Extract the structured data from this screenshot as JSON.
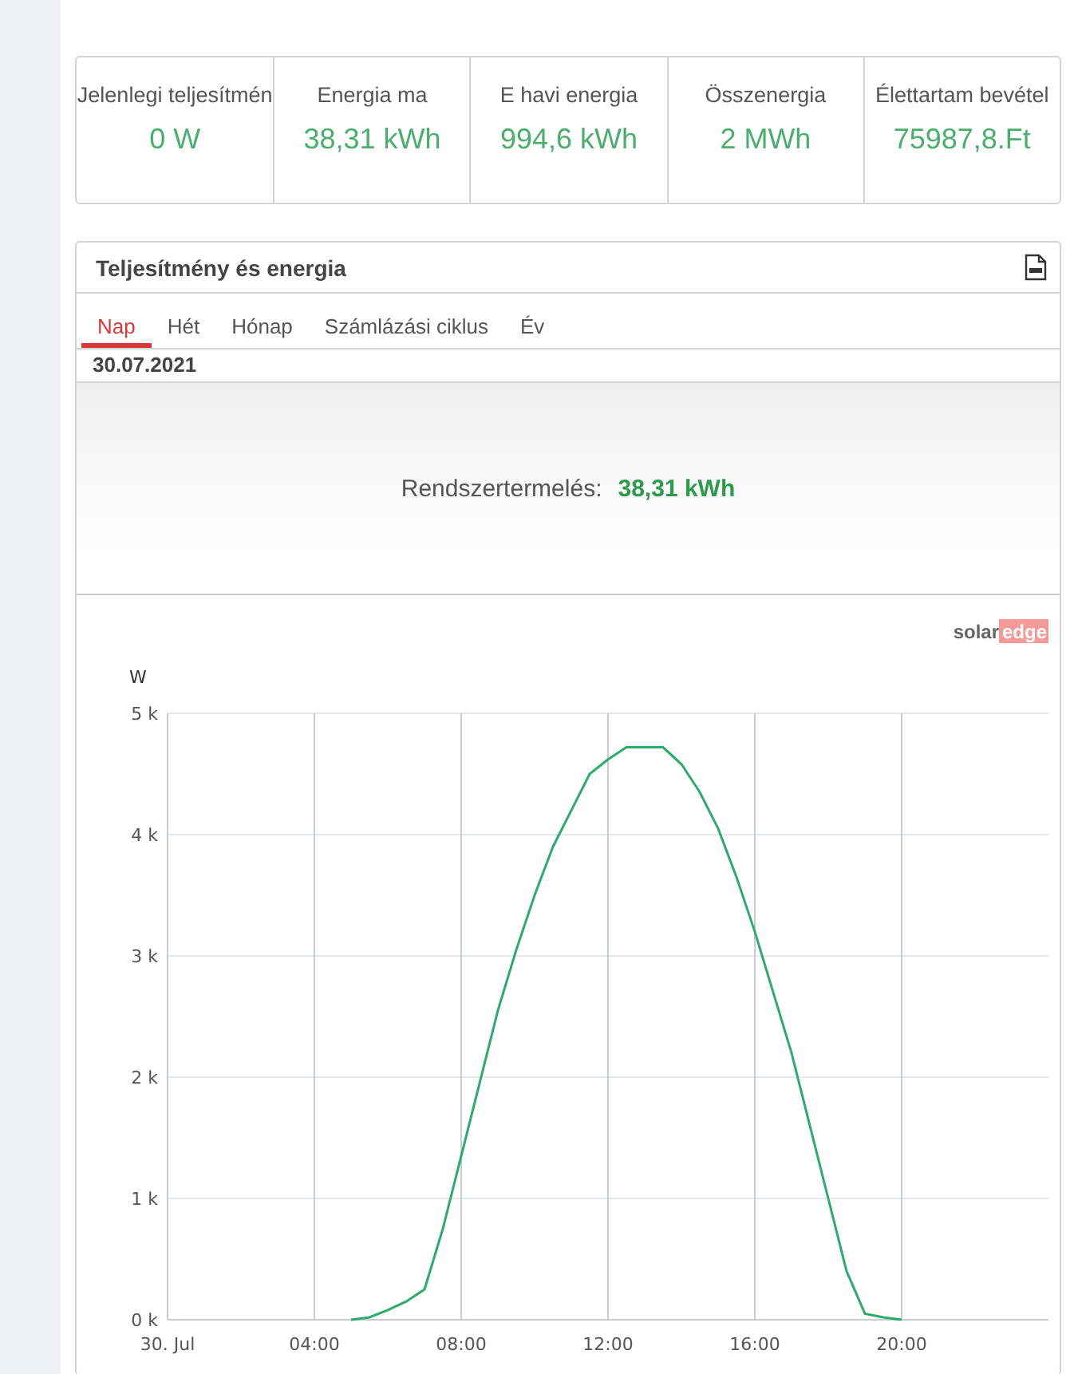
{
  "kpis": [
    {
      "label": "Jelenlegi teljesítmén",
      "value": "0 W"
    },
    {
      "label": "Energia ma",
      "value": "38,31 kWh"
    },
    {
      "label": "E havi energia",
      "value": "994,6 kWh"
    },
    {
      "label": "Összenergia",
      "value": "2 MWh"
    },
    {
      "label": "Élettartam bevétel",
      "value": "75987,8.Ft"
    }
  ],
  "panel": {
    "title": "Teljesítmény és energia",
    "tabs": [
      {
        "label": "Nap",
        "selected": true
      },
      {
        "label": "Hét",
        "selected": false
      },
      {
        "label": "Hónap",
        "selected": false
      },
      {
        "label": "Számlázási ciklus",
        "selected": false
      },
      {
        "label": "Év",
        "selected": false
      }
    ],
    "date": "30.07.2021",
    "summary": {
      "label": "Rendszertermelés:",
      "value": "38,31 kWh"
    },
    "logo": {
      "part_1": "solar",
      "part_2": "edge"
    },
    "chart_data": {
      "type": "line",
      "ylabel": "W",
      "x": [
        5,
        5.5,
        6,
        6.5,
        7,
        7.5,
        8,
        8.5,
        9,
        9.5,
        10,
        10.5,
        11,
        11.5,
        12,
        12.5,
        13,
        13.5,
        14,
        14.5,
        15,
        15.5,
        16,
        16.5,
        17,
        17.5,
        18,
        18.5,
        19,
        19.5,
        20
      ],
      "grid": true,
      "series": [
        {
          "color": "#2eaa6a",
          "values": [
            0,
            20,
            80,
            150,
            250,
            750,
            1350,
            1950,
            2550,
            3050,
            3500,
            3900,
            4200,
            4500,
            4620,
            4720,
            4720,
            4720,
            4580,
            4350,
            4050,
            3650,
            3200,
            2700,
            2200,
            1600,
            1000,
            400,
            50,
            20,
            0
          ]
        }
      ],
      "xlim": [
        0,
        24
      ],
      "ylim": [
        0,
        5000
      ],
      "xticks": [
        {
          "value": 0,
          "label": "30. Jul"
        },
        {
          "value": 4,
          "label": "04:00"
        },
        {
          "value": 8,
          "label": "08:00"
        },
        {
          "value": 12,
          "label": "12:00"
        },
        {
          "value": 16,
          "label": "16:00"
        },
        {
          "value": 20,
          "label": "20:00"
        }
      ],
      "yticks": [
        {
          "value": 0,
          "label": "0 k"
        },
        {
          "value": 1000,
          "label": "1 k"
        },
        {
          "value": 2000,
          "label": "2 k"
        },
        {
          "value": 3000,
          "label": "3 k"
        },
        {
          "value": 4000,
          "label": "4 k"
        },
        {
          "value": 5000,
          "label": "5 k"
        }
      ]
    }
  }
}
